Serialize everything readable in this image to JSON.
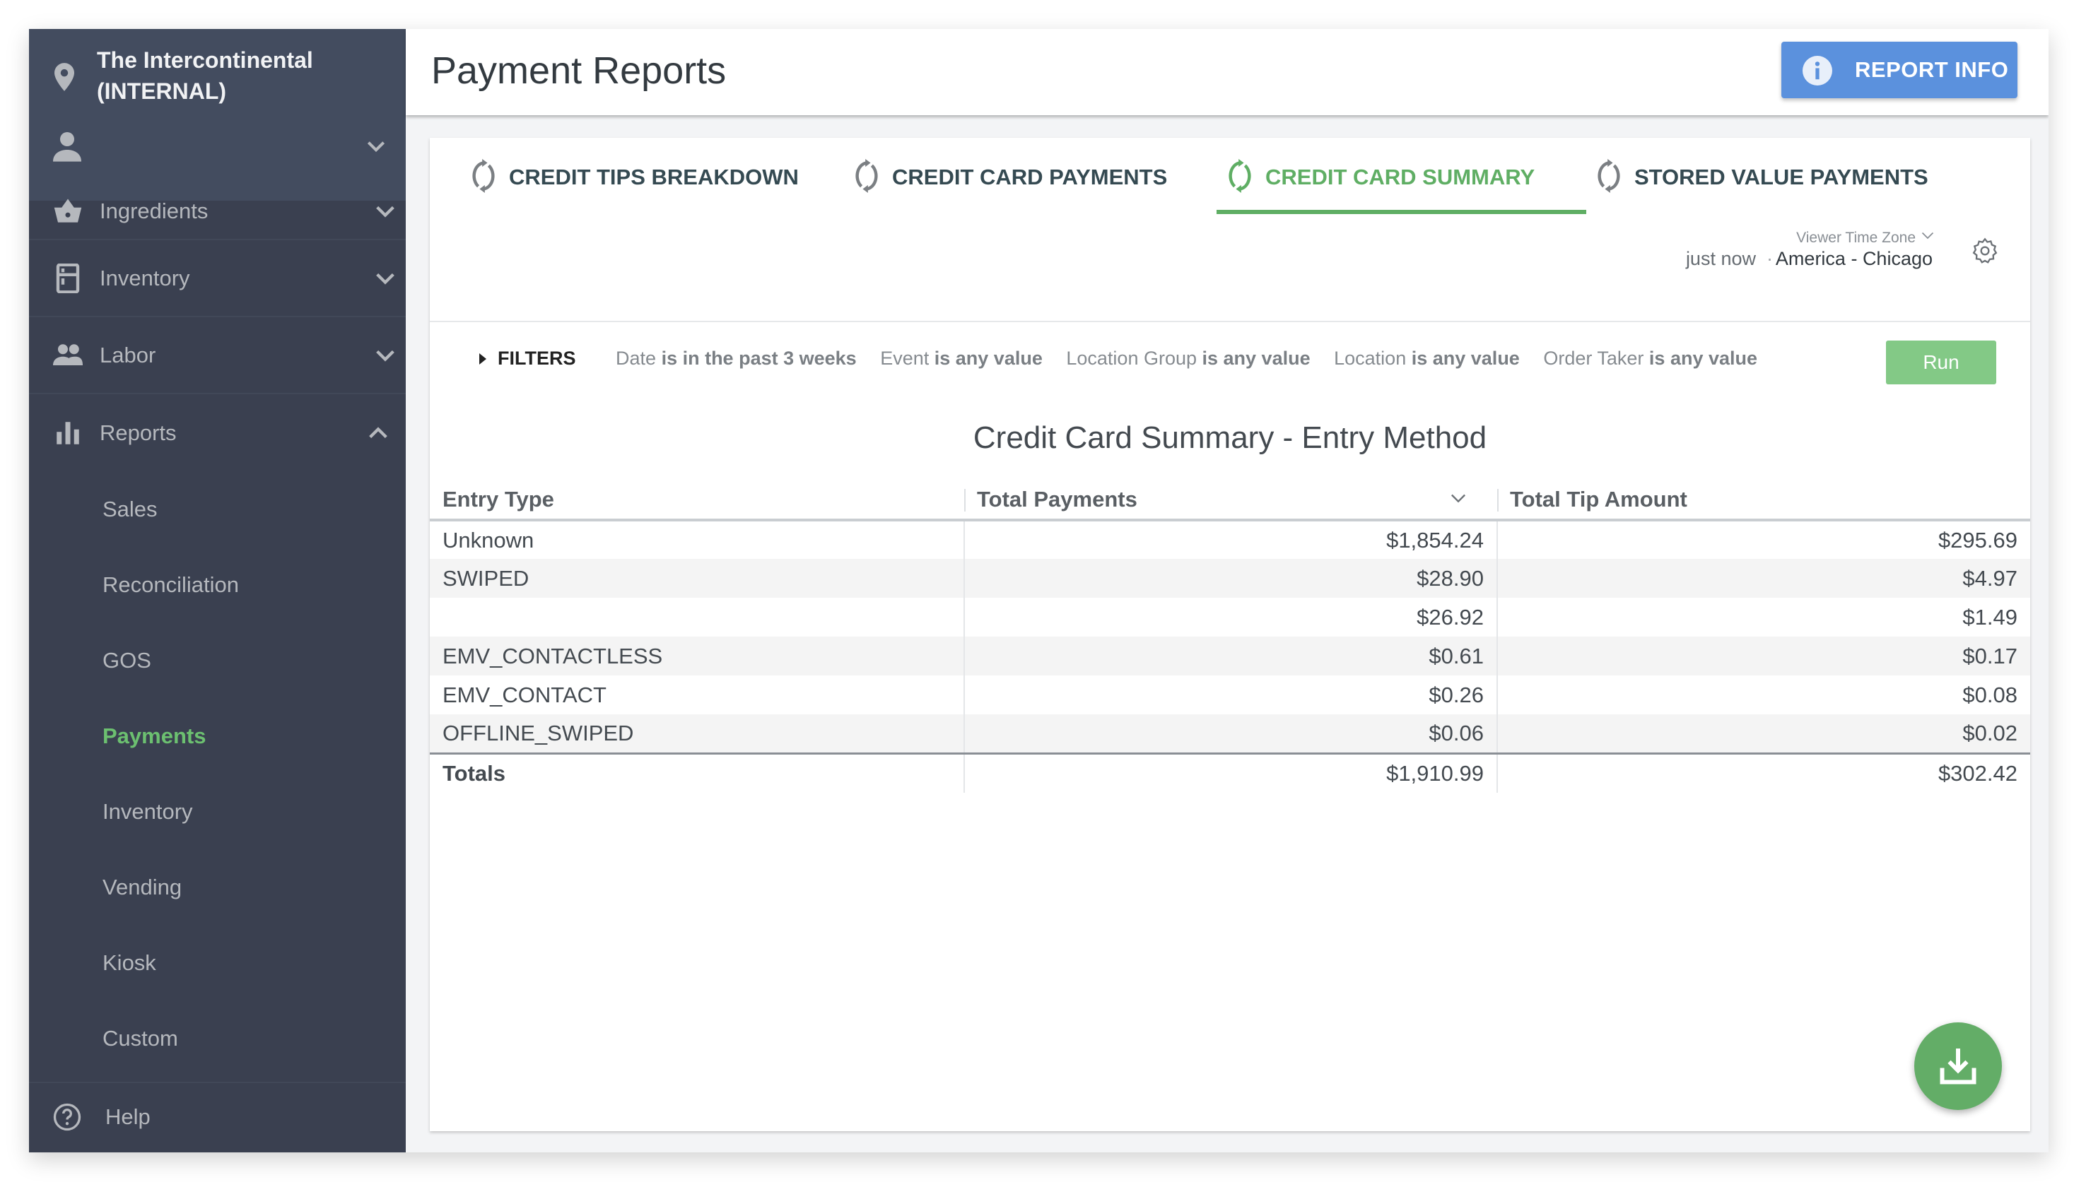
{
  "sidebar": {
    "venue_line1": "The Intercontinental",
    "venue_line2": "(INTERNAL)",
    "items": [
      {
        "label": "Ingredients",
        "icon": "basket-icon",
        "expanded": false
      },
      {
        "label": "Inventory",
        "icon": "fridge-icon",
        "expanded": false
      },
      {
        "label": "Labor",
        "icon": "people-icon",
        "expanded": false
      },
      {
        "label": "Reports",
        "icon": "bar-chart-icon",
        "expanded": true
      }
    ],
    "reports_sub": [
      {
        "label": "Sales",
        "active": false
      },
      {
        "label": "Reconciliation",
        "active": false
      },
      {
        "label": "GOS",
        "active": false
      },
      {
        "label": "Payments",
        "active": true
      },
      {
        "label": "Inventory",
        "active": false
      },
      {
        "label": "Vending",
        "active": false
      },
      {
        "label": "Kiosk",
        "active": false
      },
      {
        "label": "Custom",
        "active": false
      }
    ],
    "help_label": "Help"
  },
  "header": {
    "title": "Payment Reports",
    "report_info_label": "REPORT INFO"
  },
  "tabs": [
    {
      "label": "CREDIT TIPS BREAKDOWN",
      "active": false
    },
    {
      "label": "CREDIT CARD PAYMENTS",
      "active": false
    },
    {
      "label": "CREDIT CARD SUMMARY",
      "active": true
    },
    {
      "label": "STORED VALUE PAYMENTS",
      "active": false
    }
  ],
  "timezone": {
    "caption": "Viewer Time Zone",
    "updated": "just now",
    "separator": "·",
    "value": "America - Chicago"
  },
  "filters": {
    "toggle_label": "FILTERS",
    "items": [
      {
        "field": "Date",
        "condition": "is in the past 3 weeks"
      },
      {
        "field": "Event",
        "condition": "is any value"
      },
      {
        "field": "Location Group",
        "condition": "is any value"
      },
      {
        "field": "Location",
        "condition": "is any value"
      },
      {
        "field": "Order Taker",
        "condition": "is any value"
      }
    ],
    "run_label": "Run"
  },
  "report": {
    "title": "Credit Card Summary - Entry Method",
    "columns": [
      "Entry Type",
      "Total Payments",
      "Total Tip Amount"
    ],
    "rows": [
      [
        "Unknown",
        "$1,854.24",
        "$295.69"
      ],
      [
        "SWIPED",
        "$28.90",
        "$4.97"
      ],
      [
        "",
        "$26.92",
        "$1.49"
      ],
      [
        "EMV_CONTACTLESS",
        "$0.61",
        "$0.17"
      ],
      [
        "EMV_CONTACT",
        "$0.26",
        "$0.08"
      ],
      [
        "OFFLINE_SWIPED",
        "$0.06",
        "$0.02"
      ]
    ],
    "totals": [
      "Totals",
      "$1,910.99",
      "$302.42"
    ]
  },
  "colors": {
    "accent_green": "#5fae64",
    "sidebar_bg": "#3a4050",
    "report_info_blue": "#5b91dd"
  }
}
